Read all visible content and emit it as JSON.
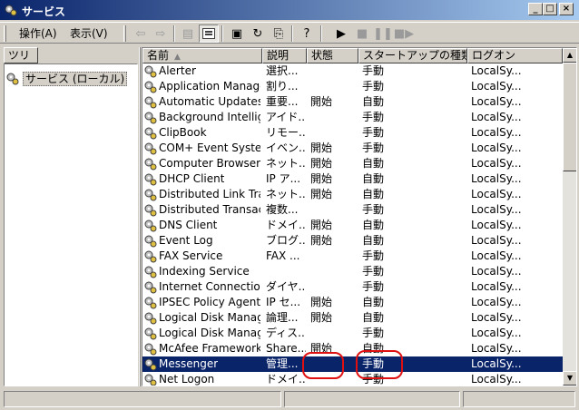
{
  "window": {
    "title": "サービス"
  },
  "menu": {
    "action": "操作(A)",
    "view": "表示(V)"
  },
  "tree": {
    "header": "ツリー",
    "root_label": "サービス (ローカル)"
  },
  "columns": {
    "name": "名前",
    "description": "説明",
    "status": "状態",
    "startup": "スタートアップの種類",
    "logon": "ログオン"
  },
  "services": [
    {
      "name": "Alerter",
      "description": "選択...",
      "status": "",
      "startup": "手動",
      "logon": "LocalSy..."
    },
    {
      "name": "Application Manage...",
      "description": "割り...",
      "status": "",
      "startup": "手動",
      "logon": "LocalSy..."
    },
    {
      "name": "Automatic Updates",
      "description": "重要...",
      "status": "開始",
      "startup": "自動",
      "logon": "LocalSy..."
    },
    {
      "name": "Background Intellig...",
      "description": "アイド...",
      "status": "",
      "startup": "手動",
      "logon": "LocalSy..."
    },
    {
      "name": "ClipBook",
      "description": "リモー...",
      "status": "",
      "startup": "手動",
      "logon": "LocalSy..."
    },
    {
      "name": "COM+ Event System",
      "description": "イベン...",
      "status": "開始",
      "startup": "手動",
      "logon": "LocalSy..."
    },
    {
      "name": "Computer Browser",
      "description": "ネット...",
      "status": "開始",
      "startup": "自動",
      "logon": "LocalSy..."
    },
    {
      "name": "DHCP Client",
      "description": "IP ア...",
      "status": "開始",
      "startup": "自動",
      "logon": "LocalSy..."
    },
    {
      "name": "Distributed Link Tra...",
      "description": "ネット...",
      "status": "開始",
      "startup": "自動",
      "logon": "LocalSy..."
    },
    {
      "name": "Distributed Transac...",
      "description": "複数...",
      "status": "",
      "startup": "手動",
      "logon": "LocalSy..."
    },
    {
      "name": "DNS Client",
      "description": "ドメイ...",
      "status": "開始",
      "startup": "自動",
      "logon": "LocalSy..."
    },
    {
      "name": "Event Log",
      "description": "ブログ...",
      "status": "開始",
      "startup": "自動",
      "logon": "LocalSy..."
    },
    {
      "name": "FAX Service",
      "description": "FAX ...",
      "status": "",
      "startup": "手動",
      "logon": "LocalSy..."
    },
    {
      "name": "Indexing Service",
      "description": "",
      "status": "",
      "startup": "手動",
      "logon": "LocalSy..."
    },
    {
      "name": "Internet Connection...",
      "description": "ダイヤ...",
      "status": "",
      "startup": "手動",
      "logon": "LocalSy..."
    },
    {
      "name": "IPSEC Policy Agent",
      "description": "IP セ...",
      "status": "開始",
      "startup": "自動",
      "logon": "LocalSy..."
    },
    {
      "name": "Logical Disk Manag...",
      "description": "論理...",
      "status": "開始",
      "startup": "自動",
      "logon": "LocalSy..."
    },
    {
      "name": "Logical Disk Manag...",
      "description": "ディス...",
      "status": "",
      "startup": "手動",
      "logon": "LocalSy..."
    },
    {
      "name": "McAfee Framework...",
      "description": "Share...",
      "status": "開始",
      "startup": "自動",
      "logon": "LocalSy..."
    },
    {
      "name": "Messenger",
      "description": "管理...",
      "status": "",
      "startup": "手動",
      "logon": "LocalSy...",
      "selected": true
    },
    {
      "name": "Net Logon",
      "description": "ドメイ...",
      "status": "",
      "startup": "手動",
      "logon": "LocalSy..."
    }
  ],
  "colors": {
    "selection": "#0a246a",
    "annotation": "#e01010",
    "chrome": "#d4d0c8"
  }
}
